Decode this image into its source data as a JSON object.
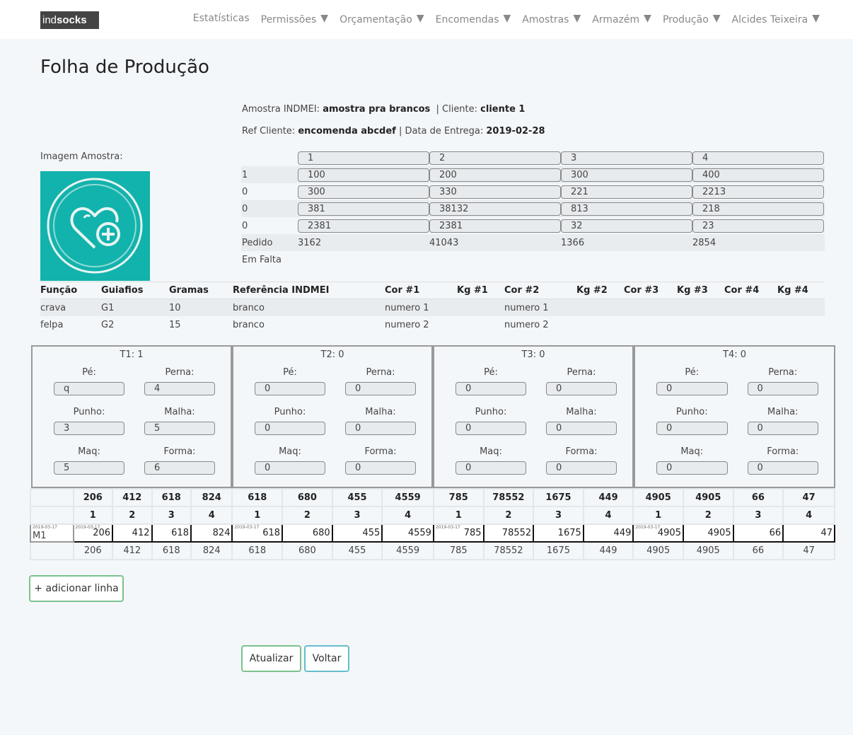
{
  "nav": {
    "logo_prefix": "ind",
    "logo_brand": "socks",
    "items": [
      {
        "label": "Estatísticas",
        "dropdown": false
      },
      {
        "label": "Permissões",
        "dropdown": true
      },
      {
        "label": "Orçamentação",
        "dropdown": true
      },
      {
        "label": "Encomendas",
        "dropdown": true
      },
      {
        "label": "Amostras",
        "dropdown": true
      },
      {
        "label": "Armazém",
        "dropdown": true
      },
      {
        "label": "Produção",
        "dropdown": true
      },
      {
        "label": "Alcides Teixeira",
        "dropdown": true
      }
    ]
  },
  "page_title": "Folha de Produção",
  "meta": {
    "amostra_label": "Amostra INDMEI:",
    "amostra_value": "amostra pra brancos",
    "cliente_label": "| Cliente:",
    "cliente_value": "cliente 1",
    "ref_label": "Ref Cliente:",
    "ref_value": "encomenda abcdef",
    "entrega_label": "| Data de Entrega:",
    "entrega_value": "2019-02-28"
  },
  "image_label": "Imagem Amostra:",
  "sizes": {
    "header": [
      "1",
      "2",
      "3",
      "4"
    ],
    "rows": [
      {
        "label": "1",
        "values": [
          "100",
          "200",
          "300",
          "400"
        ]
      },
      {
        "label": "0",
        "values": [
          "300",
          "330",
          "221",
          "2213"
        ]
      },
      {
        "label": "0",
        "values": [
          "381",
          "38132",
          "813",
          "218"
        ]
      },
      {
        "label": "0",
        "values": [
          "2381",
          "2381",
          "32",
          "23"
        ]
      }
    ],
    "pedido_label": "Pedido",
    "pedido": [
      "3162",
      "41043",
      "1366",
      "2854"
    ],
    "falta_label": "Em Falta"
  },
  "functions": {
    "headers": [
      "Função",
      "Guiafios",
      "Gramas",
      "Referência INDMEI",
      "Cor #1",
      "Kg #1",
      "Cor #2",
      "Kg #2",
      "Cor #3",
      "Kg #3",
      "Cor #4",
      "Kg #4"
    ],
    "rows": [
      [
        "crava",
        "G1",
        "10",
        "branco",
        "numero 1",
        "",
        "numero 1",
        "",
        "",
        "",
        "",
        ""
      ],
      [
        "felpa",
        "G2",
        "15",
        "branco",
        "numero 2",
        "",
        "numero 2",
        "",
        "",
        "",
        "",
        ""
      ]
    ]
  },
  "tblocks": [
    {
      "title": "T1: 1",
      "pe": "q",
      "perna": "4",
      "punho": "3",
      "malha": "5",
      "maq": "5",
      "forma": "6"
    },
    {
      "title": "T2: 0",
      "pe": "0",
      "perna": "0",
      "punho": "0",
      "malha": "0",
      "maq": "0",
      "forma": "0"
    },
    {
      "title": "T3: 0",
      "pe": "0",
      "perna": "0",
      "punho": "0",
      "malha": "0",
      "maq": "0",
      "forma": "0"
    },
    {
      "title": "T4: 0",
      "pe": "0",
      "perna": "0",
      "punho": "0",
      "malha": "0",
      "maq": "0",
      "forma": "0"
    }
  ],
  "tlabels": {
    "pe": "Pé:",
    "perna": "Perna:",
    "punho": "Punho:",
    "malha": "Malha:",
    "maq": "Maq:",
    "forma": "Forma:"
  },
  "grid": {
    "totals": [
      "206",
      "412",
      "618",
      "824",
      "618",
      "680",
      "455",
      "4559",
      "785",
      "78552",
      "1675",
      "449",
      "4905",
      "4905",
      "66",
      "47"
    ],
    "sizes": [
      "1",
      "2",
      "3",
      "4",
      "1",
      "2",
      "3",
      "4",
      "1",
      "2",
      "3",
      "4",
      "1",
      "2",
      "3",
      "4"
    ],
    "entry_date": "2019-03-17",
    "entry_machine": "M1",
    "entry_values": [
      "206",
      "412",
      "618",
      "824",
      "618",
      "680",
      "455",
      "4559",
      "785",
      "78552",
      "1675",
      "449",
      "4905",
      "4905",
      "66",
      "47"
    ],
    "sums": [
      "206",
      "412",
      "618",
      "824",
      "618",
      "680",
      "455",
      "4559",
      "785",
      "78552",
      "1675",
      "449",
      "4905",
      "4905",
      "66",
      "47"
    ]
  },
  "buttons": {
    "add_line": "+ adicionar linha",
    "update": "Atualizar",
    "back": "Voltar"
  }
}
